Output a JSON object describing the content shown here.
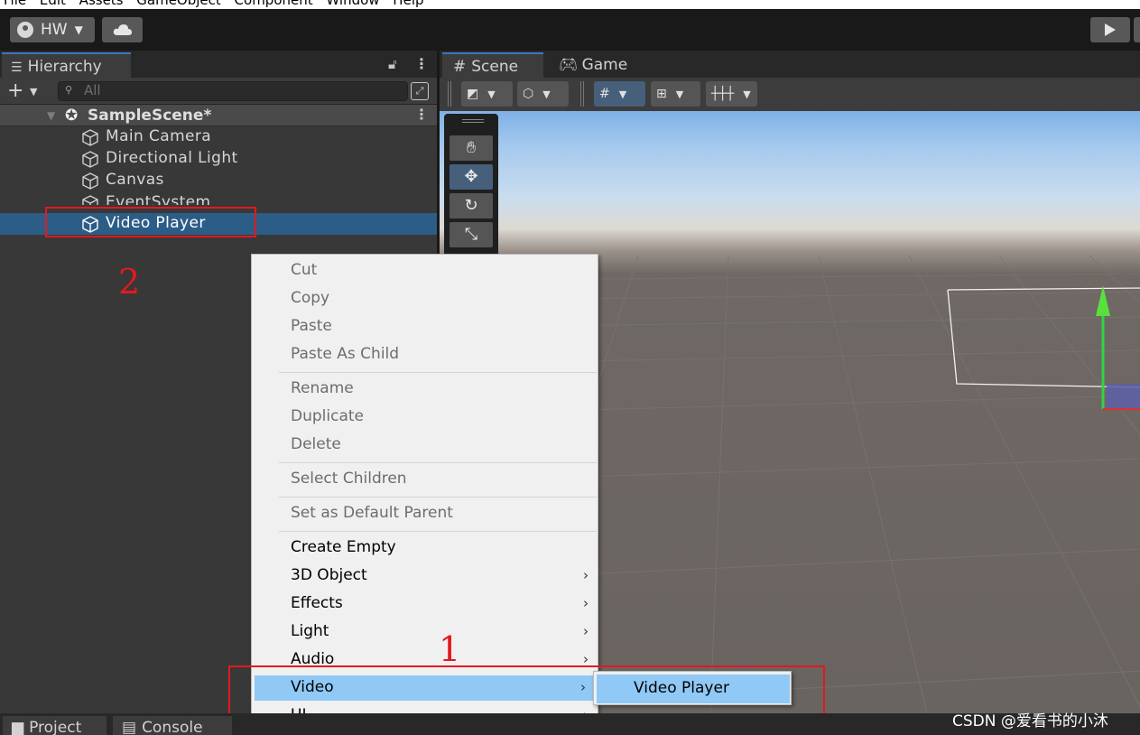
{
  "menubar": {
    "items_text": "File Edit Assets GameObject Component Window Help"
  },
  "toolbar": {
    "account_label": "HW",
    "account_icon": "account-icon",
    "cloud_icon": "cloud-icon",
    "play_icon": "play-icon"
  },
  "hierarchy": {
    "tab_label": "Hierarchy",
    "add_label": "+",
    "search_placeholder": "All",
    "scene_name": "SampleScene*",
    "items": [
      {
        "label": "Main Camera"
      },
      {
        "label": "Directional Light"
      },
      {
        "label": "Canvas"
      },
      {
        "label": "EventSystem"
      },
      {
        "label": "Video Player",
        "selected": true
      }
    ]
  },
  "scene_view": {
    "tabs": [
      {
        "label": "Scene"
      },
      {
        "label": "Game"
      }
    ]
  },
  "context_menu": {
    "items": [
      {
        "label": "Cut",
        "enabled": false
      },
      {
        "label": "Copy",
        "enabled": false
      },
      {
        "label": "Paste",
        "enabled": false
      },
      {
        "label": "Paste As Child",
        "enabled": false
      },
      {
        "label": "Rename",
        "enabled": false
      },
      {
        "label": "Duplicate",
        "enabled": false
      },
      {
        "label": "Delete",
        "enabled": false
      },
      {
        "label": "Select Children",
        "enabled": false
      },
      {
        "label": "Set as Default Parent",
        "enabled": false
      },
      {
        "label": "Create Empty",
        "enabled": true
      },
      {
        "label": "3D Object",
        "enabled": true,
        "submenu": true
      },
      {
        "label": "Effects",
        "enabled": true,
        "submenu": true
      },
      {
        "label": "Light",
        "enabled": true,
        "submenu": true
      },
      {
        "label": "Audio",
        "enabled": true,
        "submenu": true
      },
      {
        "label": "Video",
        "enabled": true,
        "submenu": true,
        "highlighted": true
      },
      {
        "label": "UI",
        "enabled": true,
        "submenu": true
      }
    ],
    "submenu_item": "Video Player"
  },
  "annotations": {
    "step1": "1",
    "step2": "2",
    "color": "#e2191f"
  },
  "bottom_tabs": [
    {
      "label": "Project"
    },
    {
      "label": "Console"
    }
  ],
  "watermark": "CSDN @爱看书的小沐",
  "colors": {
    "selection": "#2c5d87",
    "menu_highlight": "#90c8f6",
    "tab_accent": "#3a79bb"
  }
}
